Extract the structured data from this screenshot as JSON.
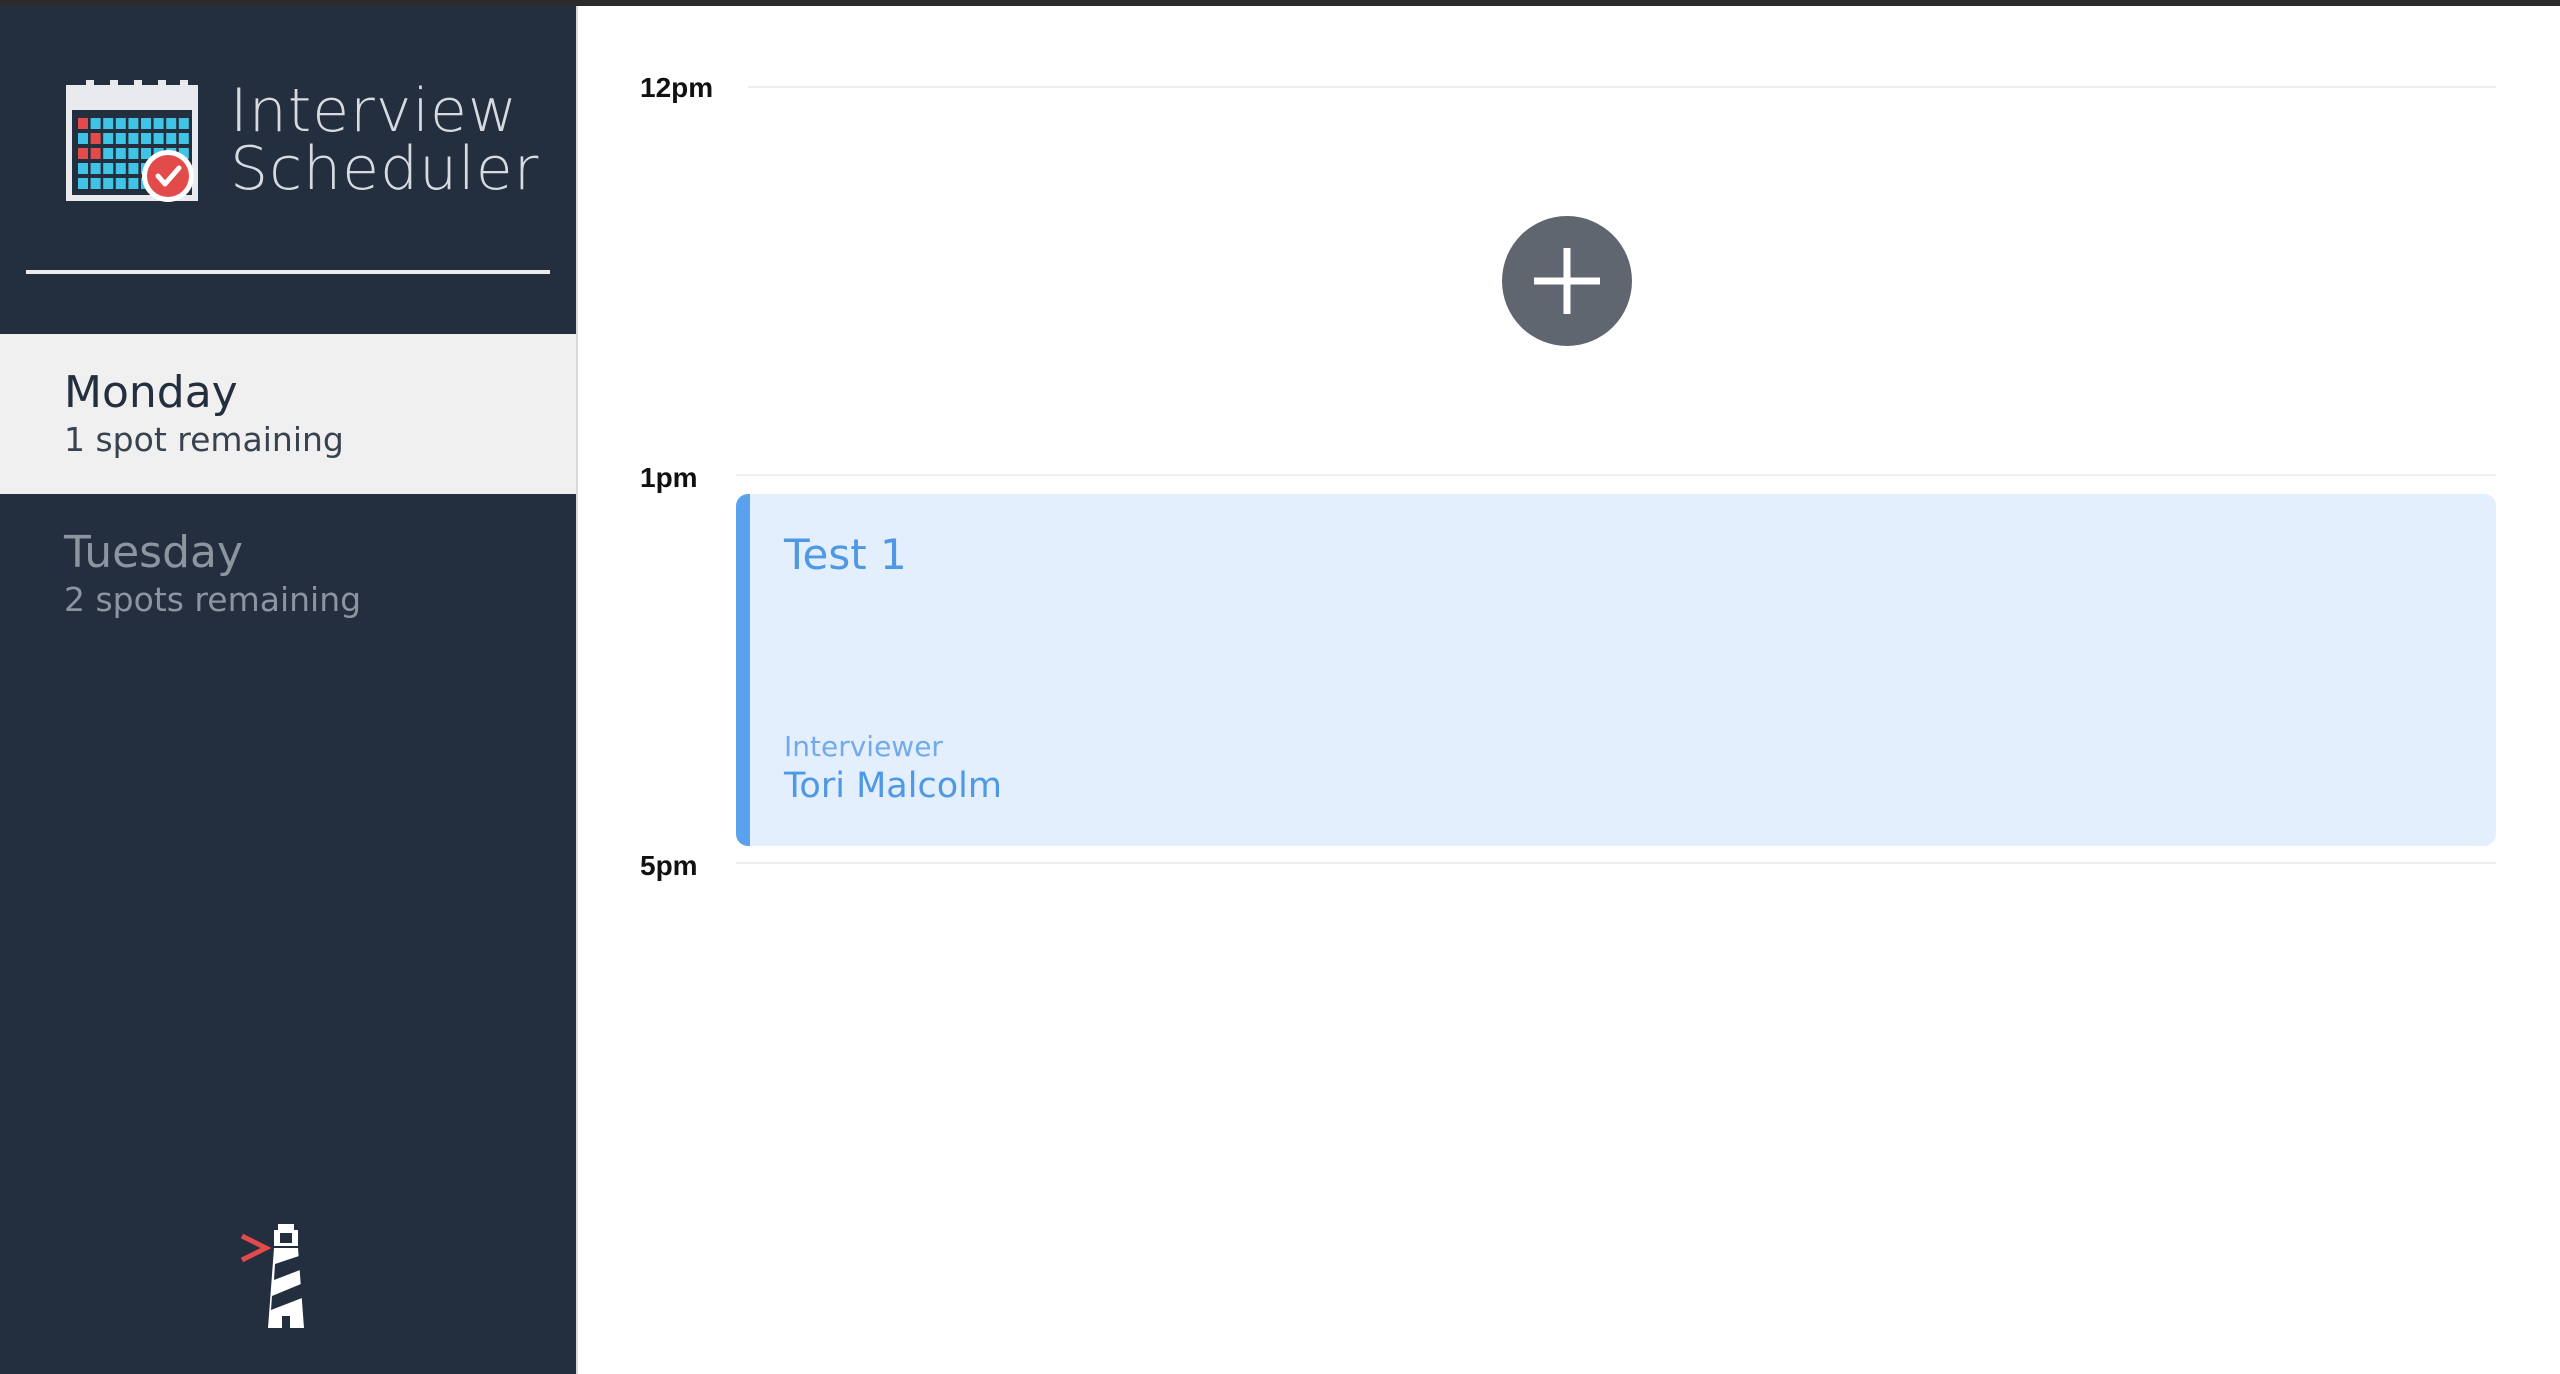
{
  "app": {
    "title_line1": "Interview",
    "title_line2": "Scheduler"
  },
  "sidebar": {
    "days": [
      {
        "name": "Monday",
        "spots": "1 spot remaining",
        "active": true
      },
      {
        "name": "Tuesday",
        "spots": "2 spots remaining",
        "active": false
      }
    ]
  },
  "schedule": {
    "times": [
      "12pm",
      "1pm",
      "5pm"
    ],
    "event": {
      "title": "Test 1",
      "role_label": "Interviewer",
      "interviewer": "Tori Malcolm"
    }
  },
  "icons": {
    "logo": "calendar-check-icon",
    "add": "plus-icon",
    "footer": "lighthouse-icon"
  },
  "colors": {
    "sidebar_bg": "#232e3e",
    "active_day_bg": "#f0f0f0",
    "event_bg": "#e3effc",
    "event_accent": "#5aa2ee",
    "add_button": "#5f6670",
    "logo_red": "#e34a4a",
    "logo_teal": "#3fc4e6"
  }
}
